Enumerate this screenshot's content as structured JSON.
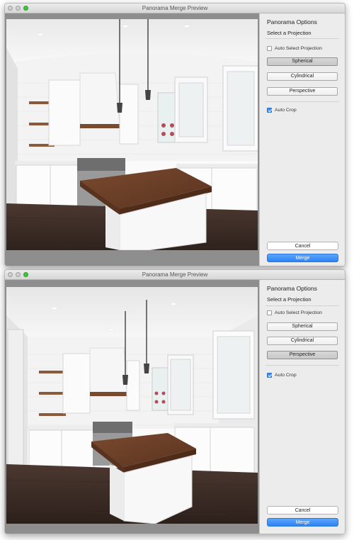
{
  "window_title": "Panorama Merge Preview",
  "panel": {
    "title": "Panorama Options",
    "subtitle": "Select a Projection",
    "auto_select_label": "Auto Select Projection",
    "buttons": {
      "spherical": "Spherical",
      "cylindrical": "Cylindrical",
      "perspective": "Perspective"
    },
    "auto_crop_label": "Auto Crop",
    "cancel_label": "Cancel",
    "merge_label": "Merge"
  },
  "windows": [
    {
      "active_projection": "Spherical",
      "auto_select_projection": false,
      "auto_crop": true
    },
    {
      "active_projection": "Perspective",
      "auto_select_projection": false,
      "auto_crop": true
    }
  ],
  "colors": {
    "accent": "#2d83f3",
    "close_button": "#d0d0d0",
    "zoom_button": "#3fc43a",
    "preview_background": "#8e8e8e"
  },
  "icons": [
    "close-icon",
    "minimize-icon",
    "zoom-icon",
    "checkbox-icon"
  ],
  "preview": {
    "subject": "kitchen-panorama-photo"
  }
}
